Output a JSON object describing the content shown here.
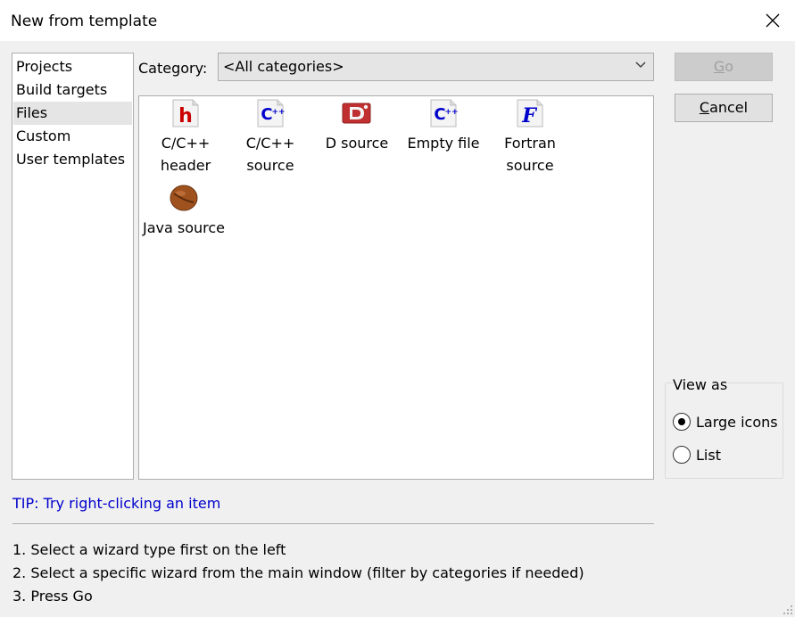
{
  "window": {
    "title": "New from template",
    "close_icon": "close-icon"
  },
  "sidebar": {
    "items": [
      {
        "label": "Projects",
        "selected": false
      },
      {
        "label": "Build targets",
        "selected": false
      },
      {
        "label": "Files",
        "selected": true
      },
      {
        "label": "Custom",
        "selected": false
      },
      {
        "label": "User templates",
        "selected": false
      }
    ]
  },
  "category": {
    "label": "Category:",
    "selected": "<All categories>"
  },
  "templates": [
    {
      "label_line1": "C/C++",
      "label_line2": "header",
      "icon": "c-header-icon",
      "icon_color": "#cc0000"
    },
    {
      "label_line1": "C/C++",
      "label_line2": "source",
      "icon": "cpp-source-icon",
      "icon_color": "#0000cc"
    },
    {
      "label_line1": "D source",
      "label_line2": "",
      "icon": "d-source-icon",
      "icon_color": "#c03030"
    },
    {
      "label_line1": "Empty file",
      "label_line2": "",
      "icon": "empty-file-icon",
      "icon_color": "#0000cc"
    },
    {
      "label_line1": "Fortran",
      "label_line2": "source",
      "icon": "fortran-source-icon",
      "icon_color": "#0000cc"
    },
    {
      "label_line1": "Java source",
      "label_line2": "",
      "icon": "java-bean-icon",
      "icon_color": "#8b4513"
    }
  ],
  "buttons": {
    "go_first": "G",
    "go_rest": "o",
    "cancel_first": "C",
    "cancel_rest": "ancel"
  },
  "view_as": {
    "legend": "View as",
    "options": [
      {
        "label": "Large icons",
        "checked": true
      },
      {
        "label": "List",
        "checked": false
      }
    ]
  },
  "tip": "TIP: Try right-clicking an item",
  "instructions": [
    "1. Select a wizard type first on the left",
    "2. Select a specific wizard from the main window (filter by categories if needed)",
    "3. Press Go"
  ],
  "colors": {
    "tip": "#0000cc",
    "dialog_bg": "#f0f0f0",
    "selected_item": "#e5e5e5"
  }
}
